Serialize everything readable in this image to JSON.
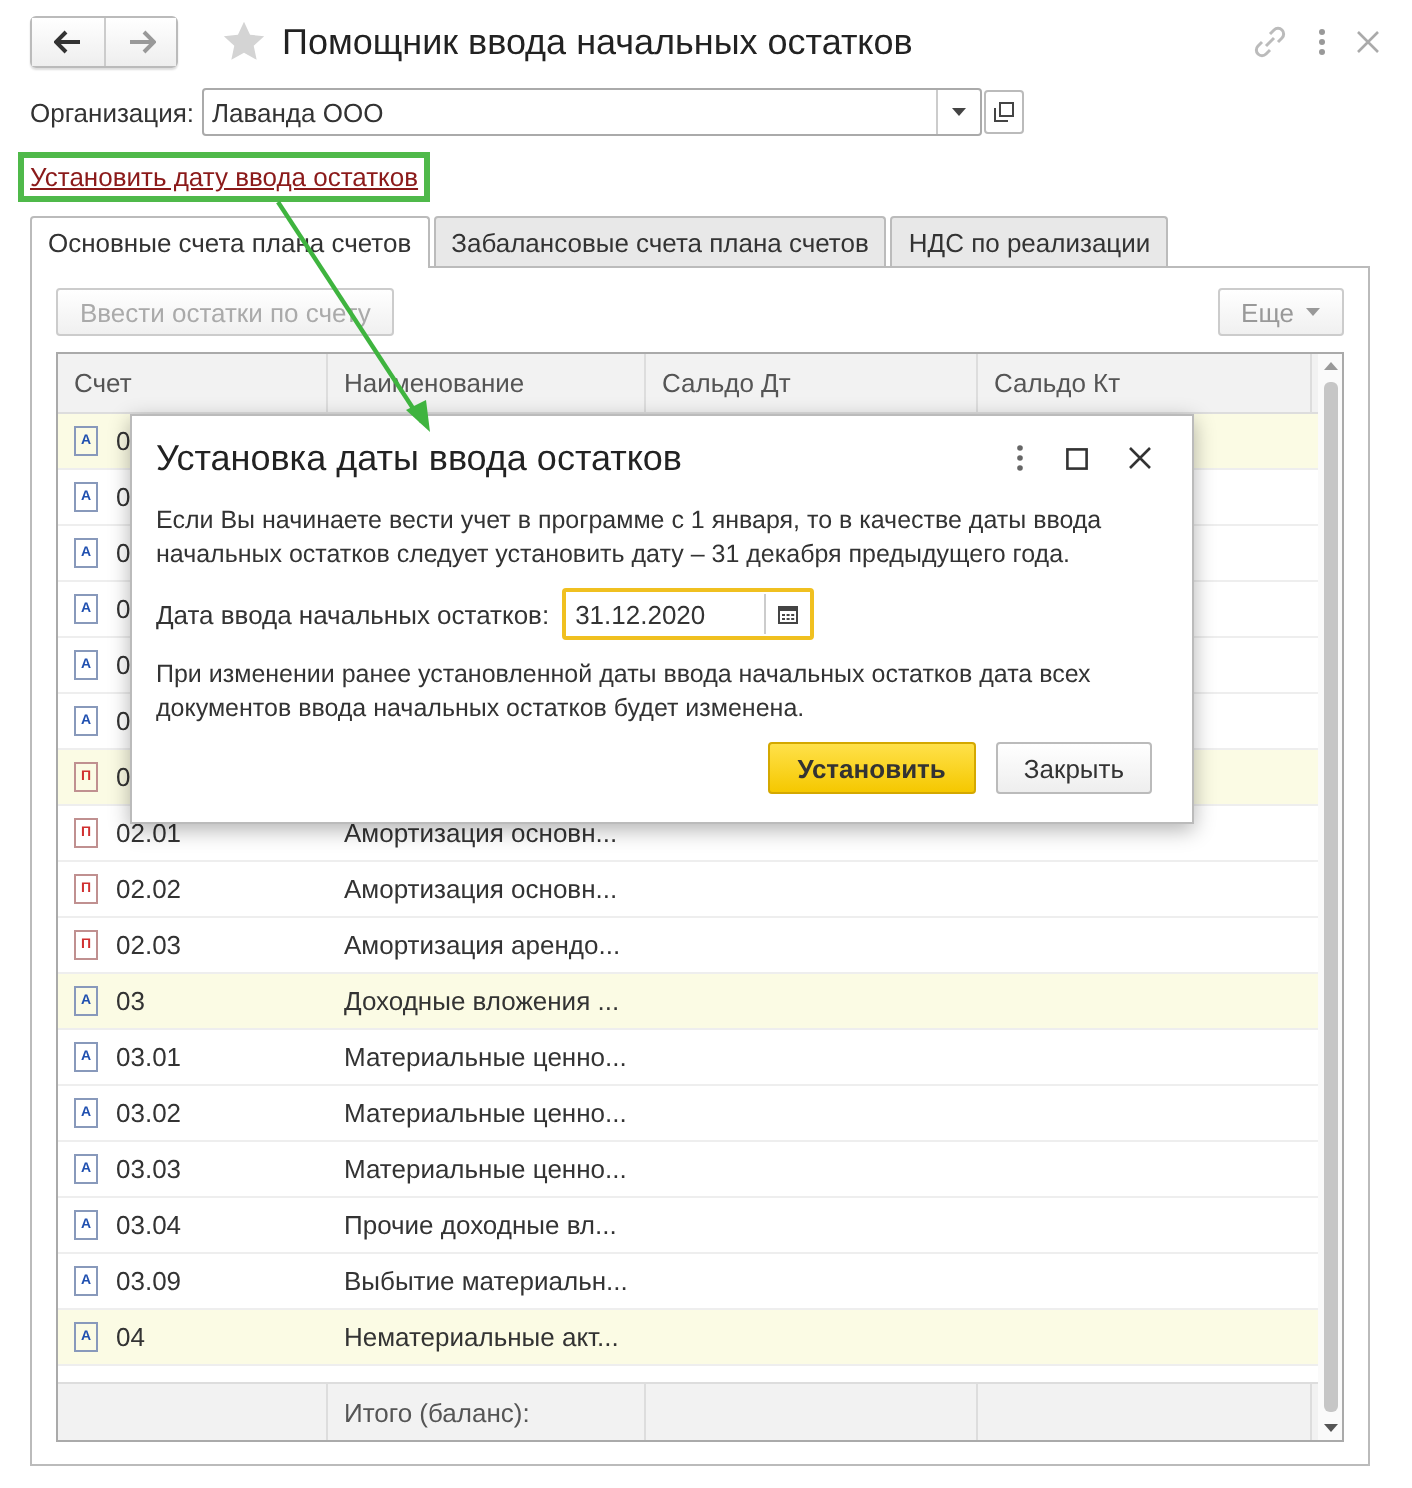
{
  "window": {
    "title": "Помощник ввода начальных остатков"
  },
  "organization": {
    "label": "Организация:",
    "value": "Лаванда ООО"
  },
  "link": "Установить дату ввода остатков",
  "tabs": [
    {
      "label": "Основные счета плана счетов",
      "selected": true
    },
    {
      "label": "Забалансовые счета плана счетов",
      "selected": false
    },
    {
      "label": "НДС по реализации",
      "selected": false
    }
  ],
  "toolbar": {
    "enter_button": {
      "label": "Ввести остатки по счету",
      "disabled": true
    },
    "more_button": "Еще"
  },
  "table": {
    "columns": [
      "Счет",
      "Наименование",
      "Сальдо Дт",
      "Сальдо Кт"
    ],
    "rows": [
      {
        "code": "0",
        "mark": "А",
        "kind": "active",
        "group": true
      },
      {
        "code": "0",
        "mark": "А",
        "kind": "active",
        "group": false
      },
      {
        "code": "0",
        "mark": "А",
        "kind": "active",
        "group": false
      },
      {
        "code": "0",
        "mark": "А",
        "kind": "active",
        "group": false
      },
      {
        "code": "0",
        "mark": "А",
        "kind": "active",
        "group": false
      },
      {
        "code": "0",
        "mark": "А",
        "kind": "active",
        "group": false
      },
      {
        "code": "0",
        "mark": "П",
        "kind": "passive",
        "group": true
      },
      {
        "code": "02.01",
        "name": "Амортизация основн...",
        "mark": "П",
        "kind": "passive",
        "group": false
      },
      {
        "code": "02.02",
        "name": "Амортизация основн...",
        "mark": "П",
        "kind": "passive",
        "group": false
      },
      {
        "code": "02.03",
        "name": "Амортизация арендо...",
        "mark": "П",
        "kind": "passive",
        "group": false
      },
      {
        "code": "03",
        "name": "Доходные вложения ...",
        "mark": "А",
        "kind": "active",
        "group": true
      },
      {
        "code": "03.01",
        "name": "Материальные ценно...",
        "mark": "А",
        "kind": "active",
        "group": false
      },
      {
        "code": "03.02",
        "name": "Материальные ценно...",
        "mark": "А",
        "kind": "active",
        "group": false
      },
      {
        "code": "03.03",
        "name": "Материальные ценно...",
        "mark": "А",
        "kind": "active",
        "group": false
      },
      {
        "code": "03.04",
        "name": "Прочие доходные вл...",
        "mark": "А",
        "kind": "active",
        "group": false
      },
      {
        "code": "03.09",
        "name": "Выбытие материальн...",
        "mark": "А",
        "kind": "active",
        "group": false
      },
      {
        "code": "04",
        "name": "Нематериальные акт...",
        "mark": "А",
        "kind": "active",
        "group": true
      }
    ],
    "footer": "Итого (баланс):"
  },
  "dialog": {
    "title": "Установка даты ввода остатков",
    "text_1": "Если Вы начинаете вести учет в программе с 1 января, то в качестве даты ввода начальных остатков следует установить дату – 31 декабря предыдущего года.",
    "date_label": "Дата ввода начальных остатков:",
    "date_value": "31.12.2020",
    "text_2": "При изменении ранее установленной даты ввода начальных остатков дата всех документов ввода начальных остатков будет изменена.",
    "buttons": [
      {
        "label": "Установить",
        "kind": "primary"
      },
      {
        "label": "Закрыть",
        "kind": "secondary"
      }
    ]
  }
}
